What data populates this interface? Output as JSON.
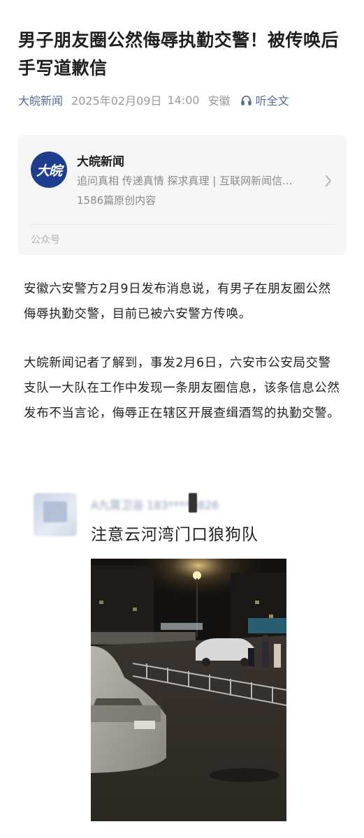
{
  "article": {
    "title": "男子朋友圈公然侮辱执勤交警！被传唤后手写道歉信",
    "source": "大皖新闻",
    "date": "2025年02月09日",
    "time": "14:00",
    "region": "安徽",
    "listen_label": "听全文"
  },
  "account_card": {
    "logo_text": "大皖",
    "name": "大皖新闻",
    "description": "追问真相 传递真情 探求真理 | 互联网新闻信...",
    "article_count": "1586篇原创内容",
    "type_label": "公众号"
  },
  "paragraphs": [
    "安徽六安警方2月9日发布消息说，有男子在朋友圈公然侮辱执勤交警，目前已被六安警方传唤。",
    "大皖新闻记者了解到，事发2月6日，六安市公安局交警支队一大队在工作中发现一条朋友圈信息，该条信息公然发布不当言论，侮辱正在辖区开展查缉酒驾的执勤交警。"
  ],
  "screenshot_post": {
    "blurred_name": "A九霄卫浴 183****5826",
    "text": "注意云河湾门口狼狗队"
  },
  "icons": {
    "listen": "headphones-icon",
    "chevron": "chevron-right-icon"
  },
  "colors": {
    "link_blue": "#576b95",
    "logo_blue": "#1e3d8c",
    "card_bg": "#f6f6f6"
  }
}
